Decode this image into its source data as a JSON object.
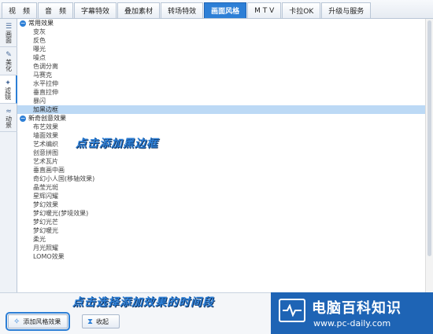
{
  "tabs": [
    {
      "label": "视　频",
      "active": false
    },
    {
      "label": "音　频",
      "active": false
    },
    {
      "label": "字幕特效",
      "active": false
    },
    {
      "label": "叠加素材",
      "active": false
    },
    {
      "label": "转场特效",
      "active": false
    },
    {
      "label": "画面风格",
      "active": true
    },
    {
      "label": "M T V",
      "active": false
    },
    {
      "label": "卡拉OK",
      "active": false
    },
    {
      "label": "升级与服务",
      "active": false
    }
  ],
  "sidebar": [
    {
      "icon": "☰",
      "label": "画面",
      "active": false
    },
    {
      "icon": "✎",
      "label": "美化",
      "active": false
    },
    {
      "icon": "✦",
      "label": "滤镜",
      "active": true
    },
    {
      "icon": "≈",
      "label": "动景",
      "active": false
    }
  ],
  "groups": [
    {
      "title": "常用效果",
      "items": [
        "变灰",
        "反色",
        "曝光",
        "噪点",
        "色调分离",
        "马赛克",
        "水平拉伸",
        "垂直拉伸",
        "暴闪",
        "加黑边框"
      ],
      "selected_index": 9
    },
    {
      "title": "新奇创意效果",
      "items": [
        "布艺效果",
        "墙面效果",
        "艺术编织",
        "创意拼图",
        "艺术瓦片",
        "垂直画中画",
        "奇幻小人国(移轴效果)",
        "晶莹光斑",
        "星辉闪耀",
        "梦幻效果",
        "梦幻暖光(梦境效果)",
        "梦幻光芒",
        "梦幻暖光",
        "柔光",
        "月光照耀",
        "LOMO效果"
      ]
    }
  ],
  "annotations": {
    "first": "点击添加黑边框",
    "second": "点击选择添加效果的时间段"
  },
  "buttons": {
    "add_label": "添加风格效果",
    "collapse_label": "收起"
  },
  "watermark": {
    "title": "电脑百科知识",
    "url": "www.pc-daily.com"
  }
}
